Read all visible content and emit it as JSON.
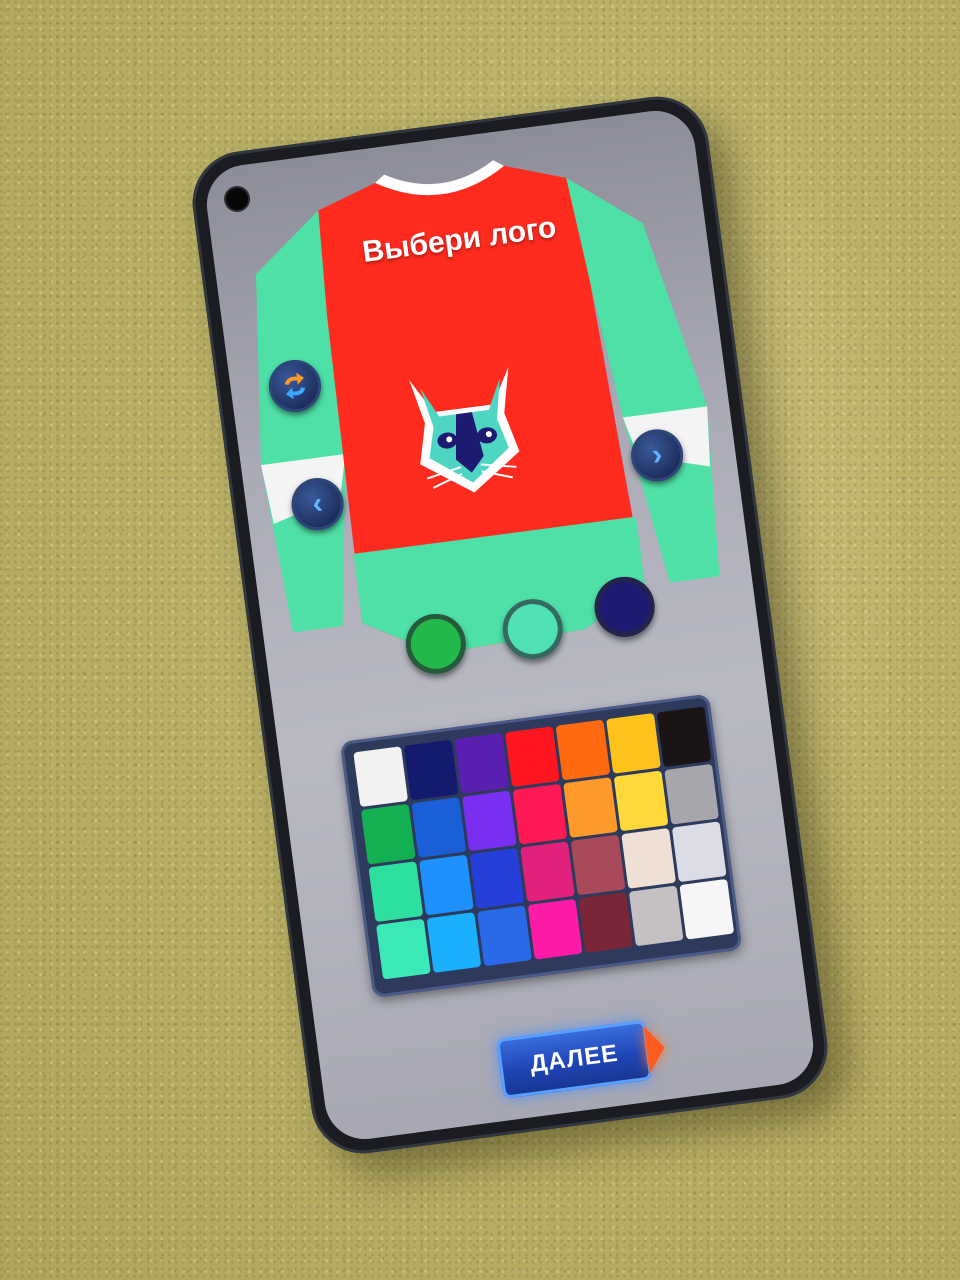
{
  "screen": {
    "title": "Выбери лого",
    "next_button": "ДАЛЕЕ"
  },
  "controls": {
    "swap_icon": "swap-arrows-icon",
    "prev_icon": "chevron-left-icon",
    "next_icon": "chevron-right-icon",
    "prev_glyph": "‹",
    "next_glyph": "›"
  },
  "jersey": {
    "body_color": "#ff2b1f",
    "sleeve_color": "#4fe0a8",
    "logo": "squirrel-logo"
  },
  "selected_colors": [
    "#22b84a",
    "#4fe0b4",
    "#1d1a72"
  ],
  "palette": [
    [
      "#f2f2f2",
      "#141a6e",
      "#5a1fb0",
      "#ff1620",
      "#ff6a10",
      "#ffc21a",
      "#1a1416"
    ],
    [
      "#12b050",
      "#1a5ed8",
      "#7a2ef0",
      "#ff1a55",
      "#ff9a2a",
      "#ffd83a",
      "#a6a6ac"
    ],
    [
      "#2ee0a0",
      "#1e90ff",
      "#2540d8",
      "#e0207a",
      "#a84a5a",
      "#eee0d4",
      "#dcdce6"
    ],
    [
      "#3ae8b8",
      "#1ab0ff",
      "#2a6ae8",
      "#ff1aa8",
      "#7a2638",
      "#c4c0c4",
      "#f6f6f8"
    ]
  ]
}
